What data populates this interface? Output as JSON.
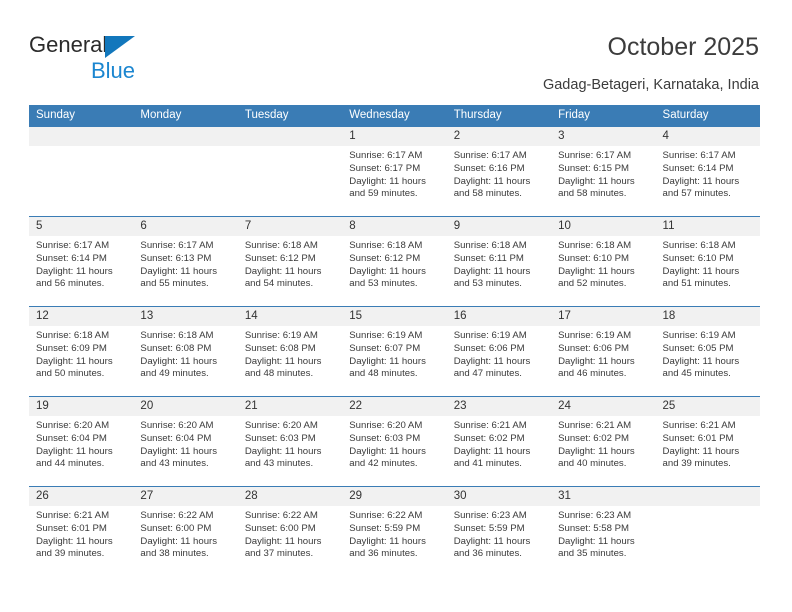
{
  "brand": {
    "name_part1": "General",
    "name_part2": "Blue",
    "logo_icon": "triangle-logo-icon",
    "colors": {
      "triangle": "#1277bc",
      "blue_text": "#1b86d0",
      "general_text": "#2b2b2b"
    }
  },
  "header": {
    "title": "October 2025",
    "subtitle": "Gadag-Betageri, Karnataka, India"
  },
  "calendar": {
    "accent_color": "#3a7cb5",
    "date_strip_color": "#f1f1f1",
    "labels": {
      "sunrise": "Sunrise:",
      "sunset": "Sunset:",
      "daylight": "Daylight:"
    },
    "weekdays": [
      "Sunday",
      "Monday",
      "Tuesday",
      "Wednesday",
      "Thursday",
      "Friday",
      "Saturday"
    ],
    "weeks": [
      [
        {
          "day": ""
        },
        {
          "day": ""
        },
        {
          "day": ""
        },
        {
          "day": "1",
          "line1": "Sunrise: 6:17 AM",
          "line2": "Sunset: 6:17 PM",
          "line3": "Daylight: 11 hours",
          "line4": "and 59 minutes."
        },
        {
          "day": "2",
          "line1": "Sunrise: 6:17 AM",
          "line2": "Sunset: 6:16 PM",
          "line3": "Daylight: 11 hours",
          "line4": "and 58 minutes."
        },
        {
          "day": "3",
          "line1": "Sunrise: 6:17 AM",
          "line2": "Sunset: 6:15 PM",
          "line3": "Daylight: 11 hours",
          "line4": "and 58 minutes."
        },
        {
          "day": "4",
          "line1": "Sunrise: 6:17 AM",
          "line2": "Sunset: 6:14 PM",
          "line3": "Daylight: 11 hours",
          "line4": "and 57 minutes."
        }
      ],
      [
        {
          "day": "5",
          "line1": "Sunrise: 6:17 AM",
          "line2": "Sunset: 6:14 PM",
          "line3": "Daylight: 11 hours",
          "line4": "and 56 minutes."
        },
        {
          "day": "6",
          "line1": "Sunrise: 6:17 AM",
          "line2": "Sunset: 6:13 PM",
          "line3": "Daylight: 11 hours",
          "line4": "and 55 minutes."
        },
        {
          "day": "7",
          "line1": "Sunrise: 6:18 AM",
          "line2": "Sunset: 6:12 PM",
          "line3": "Daylight: 11 hours",
          "line4": "and 54 minutes."
        },
        {
          "day": "8",
          "line1": "Sunrise: 6:18 AM",
          "line2": "Sunset: 6:12 PM",
          "line3": "Daylight: 11 hours",
          "line4": "and 53 minutes."
        },
        {
          "day": "9",
          "line1": "Sunrise: 6:18 AM",
          "line2": "Sunset: 6:11 PM",
          "line3": "Daylight: 11 hours",
          "line4": "and 53 minutes."
        },
        {
          "day": "10",
          "line1": "Sunrise: 6:18 AM",
          "line2": "Sunset: 6:10 PM",
          "line3": "Daylight: 11 hours",
          "line4": "and 52 minutes."
        },
        {
          "day": "11",
          "line1": "Sunrise: 6:18 AM",
          "line2": "Sunset: 6:10 PM",
          "line3": "Daylight: 11 hours",
          "line4": "and 51 minutes."
        }
      ],
      [
        {
          "day": "12",
          "line1": "Sunrise: 6:18 AM",
          "line2": "Sunset: 6:09 PM",
          "line3": "Daylight: 11 hours",
          "line4": "and 50 minutes."
        },
        {
          "day": "13",
          "line1": "Sunrise: 6:18 AM",
          "line2": "Sunset: 6:08 PM",
          "line3": "Daylight: 11 hours",
          "line4": "and 49 minutes."
        },
        {
          "day": "14",
          "line1": "Sunrise: 6:19 AM",
          "line2": "Sunset: 6:08 PM",
          "line3": "Daylight: 11 hours",
          "line4": "and 48 minutes."
        },
        {
          "day": "15",
          "line1": "Sunrise: 6:19 AM",
          "line2": "Sunset: 6:07 PM",
          "line3": "Daylight: 11 hours",
          "line4": "and 48 minutes."
        },
        {
          "day": "16",
          "line1": "Sunrise: 6:19 AM",
          "line2": "Sunset: 6:06 PM",
          "line3": "Daylight: 11 hours",
          "line4": "and 47 minutes."
        },
        {
          "day": "17",
          "line1": "Sunrise: 6:19 AM",
          "line2": "Sunset: 6:06 PM",
          "line3": "Daylight: 11 hours",
          "line4": "and 46 minutes."
        },
        {
          "day": "18",
          "line1": "Sunrise: 6:19 AM",
          "line2": "Sunset: 6:05 PM",
          "line3": "Daylight: 11 hours",
          "line4": "and 45 minutes."
        }
      ],
      [
        {
          "day": "19",
          "line1": "Sunrise: 6:20 AM",
          "line2": "Sunset: 6:04 PM",
          "line3": "Daylight: 11 hours",
          "line4": "and 44 minutes."
        },
        {
          "day": "20",
          "line1": "Sunrise: 6:20 AM",
          "line2": "Sunset: 6:04 PM",
          "line3": "Daylight: 11 hours",
          "line4": "and 43 minutes."
        },
        {
          "day": "21",
          "line1": "Sunrise: 6:20 AM",
          "line2": "Sunset: 6:03 PM",
          "line3": "Daylight: 11 hours",
          "line4": "and 43 minutes."
        },
        {
          "day": "22",
          "line1": "Sunrise: 6:20 AM",
          "line2": "Sunset: 6:03 PM",
          "line3": "Daylight: 11 hours",
          "line4": "and 42 minutes."
        },
        {
          "day": "23",
          "line1": "Sunrise: 6:21 AM",
          "line2": "Sunset: 6:02 PM",
          "line3": "Daylight: 11 hours",
          "line4": "and 41 minutes."
        },
        {
          "day": "24",
          "line1": "Sunrise: 6:21 AM",
          "line2": "Sunset: 6:02 PM",
          "line3": "Daylight: 11 hours",
          "line4": "and 40 minutes."
        },
        {
          "day": "25",
          "line1": "Sunrise: 6:21 AM",
          "line2": "Sunset: 6:01 PM",
          "line3": "Daylight: 11 hours",
          "line4": "and 39 minutes."
        }
      ],
      [
        {
          "day": "26",
          "line1": "Sunrise: 6:21 AM",
          "line2": "Sunset: 6:01 PM",
          "line3": "Daylight: 11 hours",
          "line4": "and 39 minutes."
        },
        {
          "day": "27",
          "line1": "Sunrise: 6:22 AM",
          "line2": "Sunset: 6:00 PM",
          "line3": "Daylight: 11 hours",
          "line4": "and 38 minutes."
        },
        {
          "day": "28",
          "line1": "Sunrise: 6:22 AM",
          "line2": "Sunset: 6:00 PM",
          "line3": "Daylight: 11 hours",
          "line4": "and 37 minutes."
        },
        {
          "day": "29",
          "line1": "Sunrise: 6:22 AM",
          "line2": "Sunset: 5:59 PM",
          "line3": "Daylight: 11 hours",
          "line4": "and 36 minutes."
        },
        {
          "day": "30",
          "line1": "Sunrise: 6:23 AM",
          "line2": "Sunset: 5:59 PM",
          "line3": "Daylight: 11 hours",
          "line4": "and 36 minutes."
        },
        {
          "day": "31",
          "line1": "Sunrise: 6:23 AM",
          "line2": "Sunset: 5:58 PM",
          "line3": "Daylight: 11 hours",
          "line4": "and 35 minutes."
        },
        {
          "day": ""
        }
      ]
    ]
  }
}
